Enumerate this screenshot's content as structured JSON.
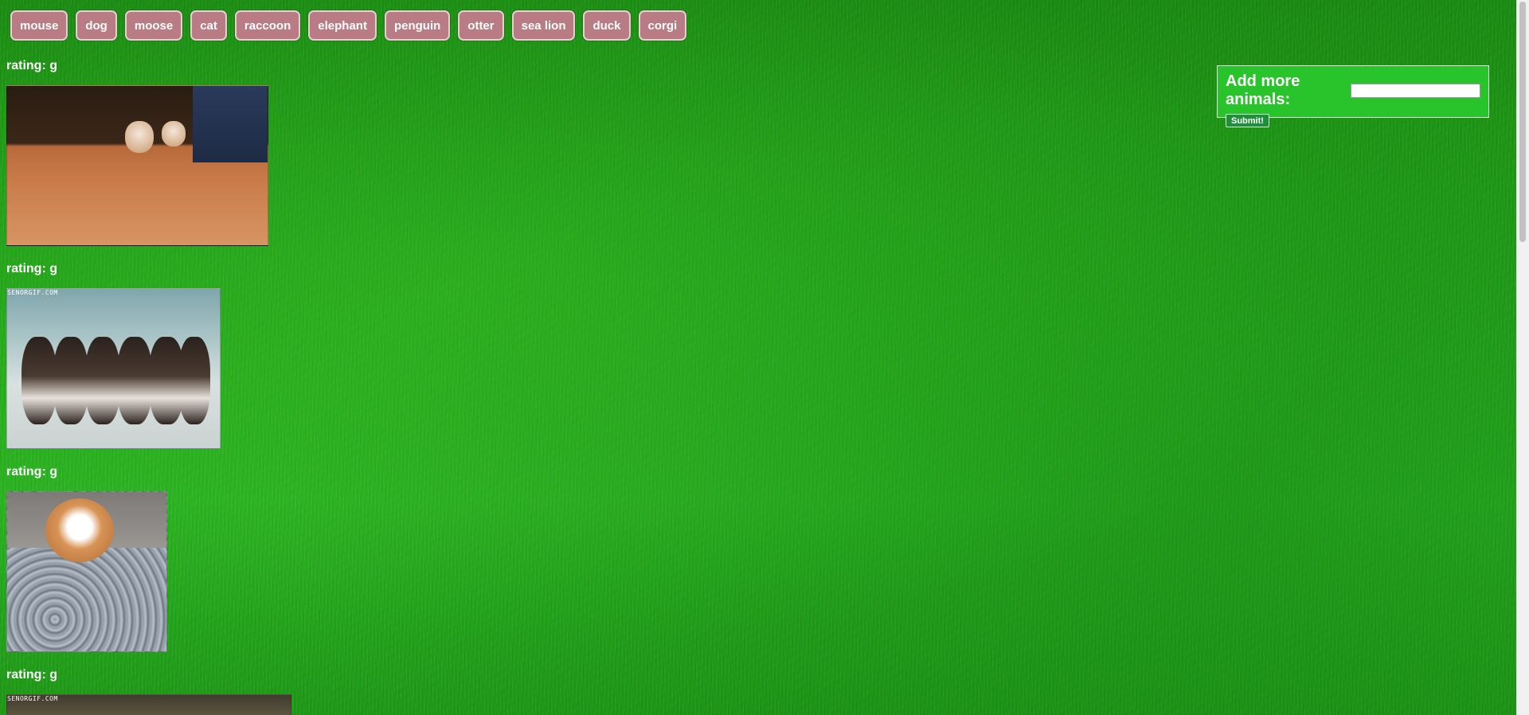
{
  "animal_buttons": [
    "mouse",
    "dog",
    "moose",
    "cat",
    "raccoon",
    "elephant",
    "penguin",
    "otter",
    "sea lion",
    "duck",
    "corgi"
  ],
  "gifs": [
    {
      "rating": "rating: g",
      "watermark": ""
    },
    {
      "rating": "rating: g",
      "watermark": "SENORGIF.COM"
    },
    {
      "rating": "rating: g",
      "watermark": ""
    },
    {
      "rating": "rating: g",
      "watermark": "SENORGIF.COM"
    }
  ],
  "form": {
    "title": "Add more animals:",
    "input_value": "",
    "submit_label": "Submit!"
  },
  "colors": {
    "button_bg": "#b97c84",
    "form_bg": "#29c32b"
  }
}
